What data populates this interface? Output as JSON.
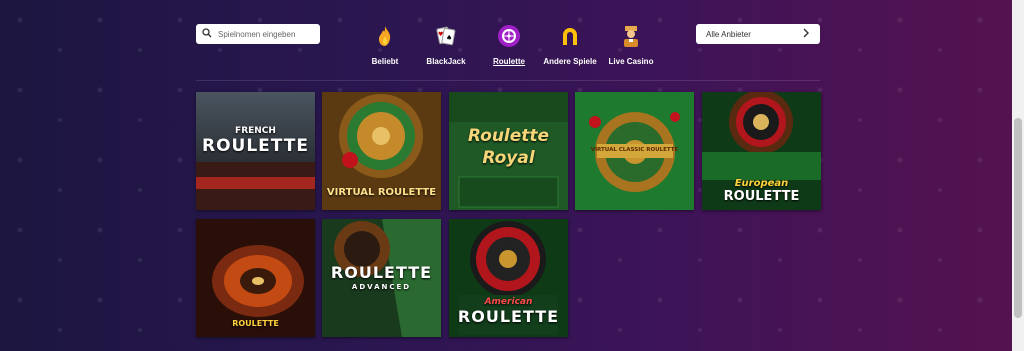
{
  "search": {
    "placeholder": "Spielnomen eingeben"
  },
  "provider_select": {
    "label": "Alle Anbieter"
  },
  "categories": [
    {
      "label": "Beliebt",
      "icon": "flame-icon"
    },
    {
      "label": "BlackJack",
      "icon": "cards-icon"
    },
    {
      "label": "Roulette",
      "icon": "roulette-icon",
      "active": true
    },
    {
      "label": "Andere Spiele",
      "icon": "horseshoe-icon"
    },
    {
      "label": "Live Casino",
      "icon": "dealer-icon"
    }
  ],
  "games": [
    {
      "title_top": "FRENCH",
      "title": "ROULETTE"
    },
    {
      "title": "VIRTUAL ROULETTE"
    },
    {
      "title": "Roulette",
      "subtitle": "Royal"
    },
    {
      "title": "VIRTUAL CLASSIC ROULETTE"
    },
    {
      "title_top": "European",
      "title": "ROULETTE"
    },
    {
      "title": "ROULETTE"
    },
    {
      "title": "ROULETTE",
      "subtitle": "ADVANCED"
    },
    {
      "title_top": "American",
      "title": "ROULETTE"
    }
  ],
  "colors": {
    "accent": "#ffd23a",
    "active_icon_bg": "#a020c8"
  }
}
